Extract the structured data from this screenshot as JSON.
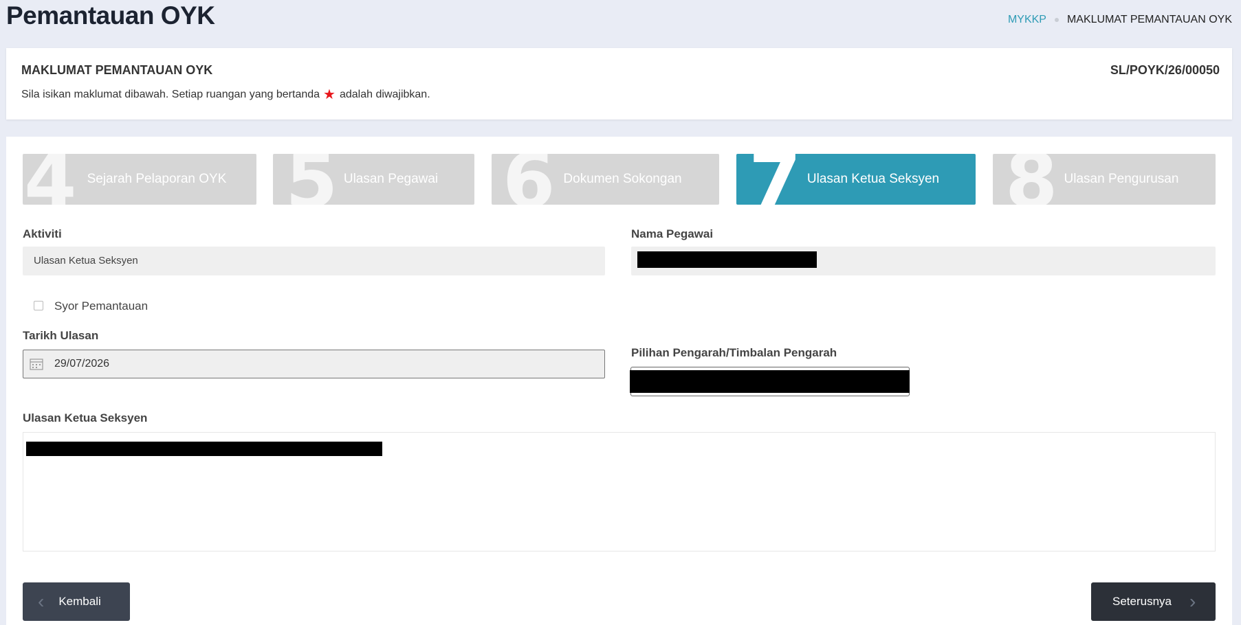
{
  "header": {
    "title": "Pemantauan OYK",
    "breadcrumb": {
      "home": "MYKKP",
      "current": "MAKLUMAT PEMANTAUAN OYK"
    }
  },
  "info": {
    "title": "MAKLUMAT PEMANTAUAN OYK",
    "reference": "SL/POYK/26/00050",
    "note_before": "Sila isikan maklumat dibawah. Setiap ruangan yang bertanda",
    "note_after": "adalah diwajibkan."
  },
  "steps": [
    {
      "number": "4",
      "label": "Sejarah Pelaporan OYK",
      "active": false
    },
    {
      "number": "5",
      "label": "Ulasan Pegawai",
      "active": false
    },
    {
      "number": "6",
      "label": "Dokumen Sokongan",
      "active": false
    },
    {
      "number": "7",
      "label": "Ulasan Ketua Seksyen",
      "active": true
    },
    {
      "number": "8",
      "label": "Ulasan Pengurusan",
      "active": false
    }
  ],
  "form": {
    "aktiviti_label": "Aktiviti",
    "aktiviti_value": "Ulasan Ketua Seksyen",
    "nama_pegawai_label": "Nama Pegawai",
    "syor_label": "Syor Pemantauan",
    "tarikh_label": "Tarikh Ulasan",
    "tarikh_value": "29/07/2026",
    "pilihan_label": "Pilihan Pengarah/Timbalan Pengarah",
    "ulasan_label": "Ulasan Ketua Seksyen"
  },
  "buttons": {
    "back": "Kembali",
    "next": "Seterusnya"
  },
  "icons": {
    "required": "star-icon",
    "date": "calendar-icon",
    "back": "chevron-left-icon",
    "next": "chevron-right-icon"
  },
  "colors": {
    "accent": "#2e9bb5",
    "required": "#e8161b"
  }
}
